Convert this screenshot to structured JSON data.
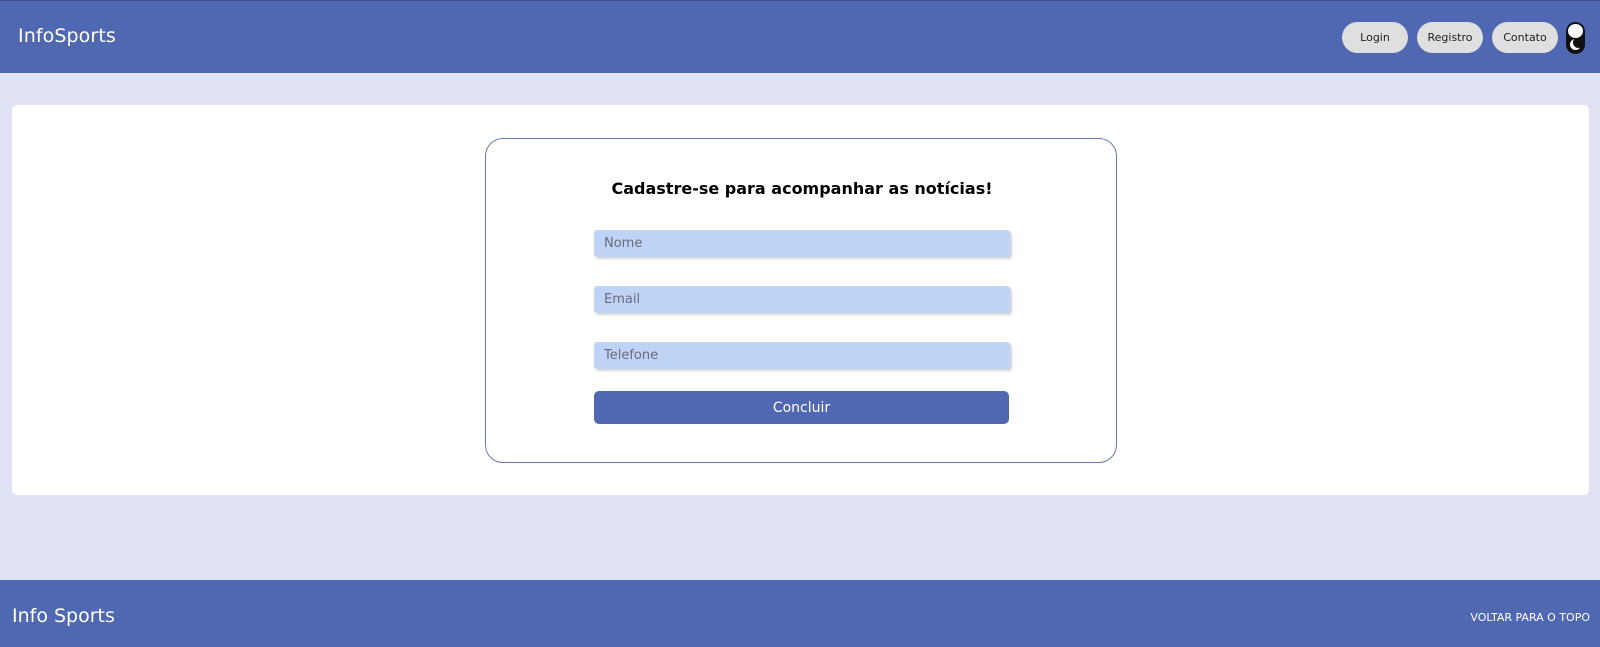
{
  "header": {
    "brand": "InfoSports",
    "nav": {
      "login": "Login",
      "registro": "Registro",
      "contato": "Contato"
    },
    "theme_toggle_icon": "moon-icon"
  },
  "form": {
    "title": "Cadastre-se para acompanhar as notícias!",
    "fields": {
      "nome_placeholder": "Nome",
      "email_placeholder": "Email",
      "telefone_placeholder": "Telefone"
    },
    "submit_label": "Concluir"
  },
  "footer": {
    "brand": "Info Sports",
    "back_to_top": "VOLTAR PARA O TOPO"
  },
  "colors": {
    "primary": "#5067b2",
    "background": "#dfe3f5",
    "input_fill": "#bfd3f6",
    "nav_button": "#dfdfdf"
  }
}
